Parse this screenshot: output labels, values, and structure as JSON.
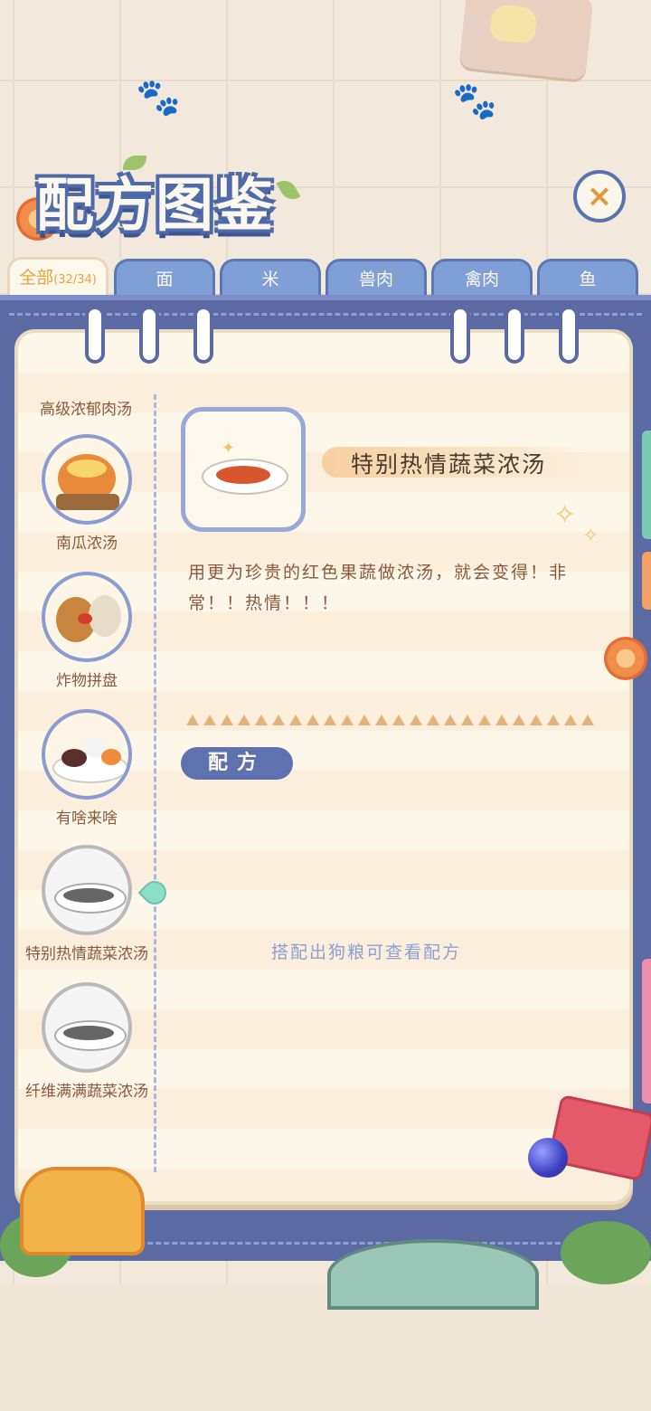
{
  "header": {
    "title": "配方图鉴",
    "close_symbol": "×"
  },
  "tabs": [
    {
      "label": "全部",
      "count": "(32/34)",
      "active": true
    },
    {
      "label": "面"
    },
    {
      "label": "米"
    },
    {
      "label": "兽肉"
    },
    {
      "label": "禽肉"
    },
    {
      "label": "鱼"
    }
  ],
  "sidebar": {
    "header": "高级浓郁肉汤",
    "items": [
      {
        "label": "南瓜浓汤",
        "icon": "pumpkin-soup-icon",
        "locked": false
      },
      {
        "label": "炸物拼盘",
        "icon": "fried-platter-icon",
        "locked": false
      },
      {
        "label": "有啥来啥",
        "icon": "mixed-plate-icon",
        "locked": false
      },
      {
        "label": "特别热情蔬菜浓汤",
        "icon": "locked-soup-icon",
        "locked": true
      },
      {
        "label": "纤维满满蔬菜浓汤",
        "icon": "locked-soup-icon",
        "locked": true
      }
    ]
  },
  "detail": {
    "name": "特别热情蔬菜浓汤",
    "description": "用更为珍贵的红色果蔬做浓汤，就会变得！非常！！热情！！！",
    "recipe_tag": "配方",
    "hint": "搭配出狗粮可查看配方"
  },
  "colors": {
    "accent_blue": "#5c6aa3",
    "tab_blue": "#7f9fd6",
    "active_tab_text": "#e9a23d",
    "text_brown": "#8a5a3c",
    "hint_blue": "#8b9fd0"
  }
}
